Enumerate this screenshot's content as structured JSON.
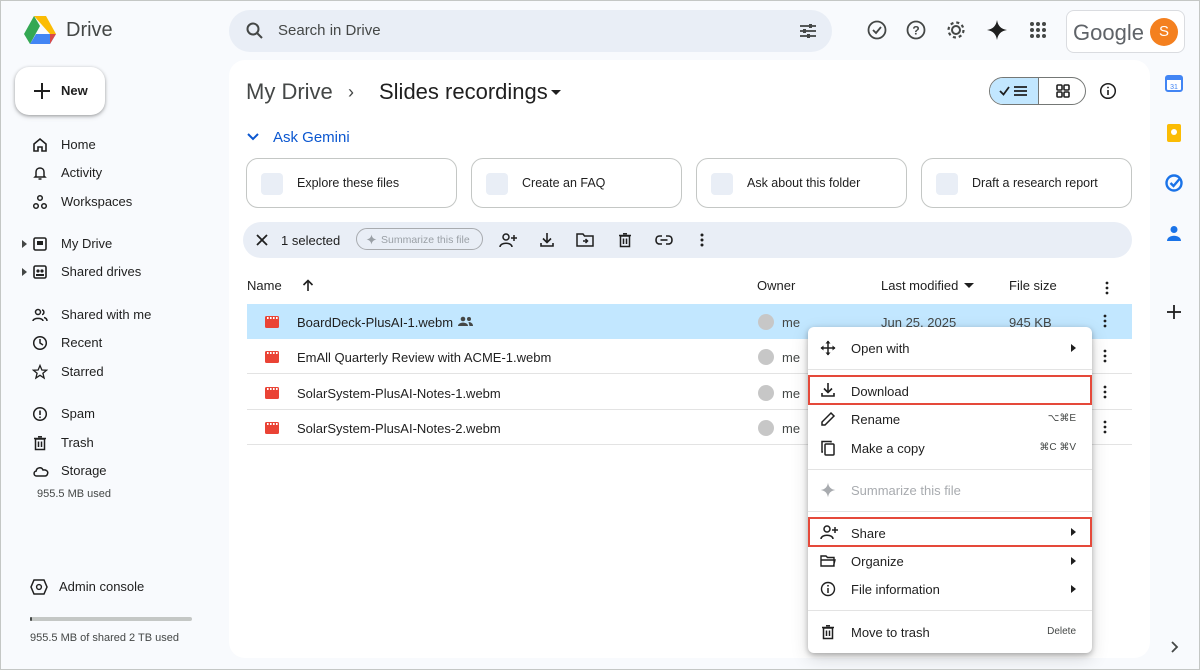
{
  "app": {
    "name": "Drive",
    "search_placeholder": "Search in Drive",
    "google_wordmark": "Google",
    "avatar_letter": "S",
    "accent_color": "#0b57d0",
    "selected_row_color": "#c2e7ff",
    "highlight_border_color": "#e5493a"
  },
  "sidebar": {
    "new_label": "New",
    "items": [
      {
        "label": "Home",
        "icon": "home-icon"
      },
      {
        "label": "Activity",
        "icon": "bell-icon"
      },
      {
        "label": "Workspaces",
        "icon": "workspaces-icon"
      },
      {
        "label": "My Drive",
        "icon": "drive-icon"
      },
      {
        "label": "Shared drives",
        "icon": "shared-drives-icon"
      },
      {
        "label": "Shared with me",
        "icon": "people-icon"
      },
      {
        "label": "Recent",
        "icon": "clock-icon"
      },
      {
        "label": "Starred",
        "icon": "star-icon"
      },
      {
        "label": "Spam",
        "icon": "spam-icon"
      },
      {
        "label": "Trash",
        "icon": "trash-icon"
      },
      {
        "label": "Storage",
        "icon": "cloud-icon"
      }
    ],
    "storage_used": "955.5 MB used",
    "admin_label": "Admin console",
    "quota_text": "955.5 MB of shared 2 TB used",
    "quota_fraction": 0.0005
  },
  "main": {
    "crumb_root": "My Drive",
    "crumb_sep": "›",
    "crumb_current": "Slides recordings",
    "gemini_label": "Ask Gemini",
    "chips": [
      {
        "label": "Explore these files"
      },
      {
        "label": "Create an FAQ"
      },
      {
        "label": "Ask about this folder"
      },
      {
        "label": "Draft a research report"
      }
    ],
    "selection": {
      "count_label": "1 selected",
      "summarize_label": "Summarize this file"
    },
    "columns": {
      "name": "Name",
      "owner": "Owner",
      "modified": "Last modified",
      "size": "File size"
    },
    "files": [
      {
        "name": "BoardDeck-PlusAI-1.webm",
        "owner": "me",
        "modified": "Jun 25, 2025",
        "size": "945 KB"
      },
      {
        "name": "EmAll Quarterly Review with ACME-1.webm",
        "owner": "me",
        "modified": "",
        "size": ""
      },
      {
        "name": "SolarSystem-PlusAI-Notes-1.webm",
        "owner": "me",
        "modified": "",
        "size": ""
      },
      {
        "name": "SolarSystem-PlusAI-Notes-2.webm",
        "owner": "me",
        "modified": "",
        "size": ""
      }
    ]
  },
  "context_menu": {
    "items": [
      {
        "label": "Open with",
        "icon": "move-icon",
        "shortcut": ""
      },
      {
        "label": "Download",
        "icon": "download-icon",
        "shortcut": ""
      },
      {
        "label": "Rename",
        "icon": "edit-icon",
        "shortcut": "⌥⌘E"
      },
      {
        "label": "Make a copy",
        "icon": "copy-icon",
        "shortcut": "⌘C ⌘V"
      },
      {
        "label": "Summarize this file",
        "icon": "sparkle-icon",
        "shortcut": ""
      },
      {
        "label": "Share",
        "icon": "share-person-icon",
        "shortcut": ""
      },
      {
        "label": "Organize",
        "icon": "folder-icon",
        "shortcut": ""
      },
      {
        "label": "File information",
        "icon": "info-icon",
        "shortcut": ""
      },
      {
        "label": "Move to trash",
        "icon": "trash-icon",
        "shortcut": "Delete"
      }
    ]
  }
}
